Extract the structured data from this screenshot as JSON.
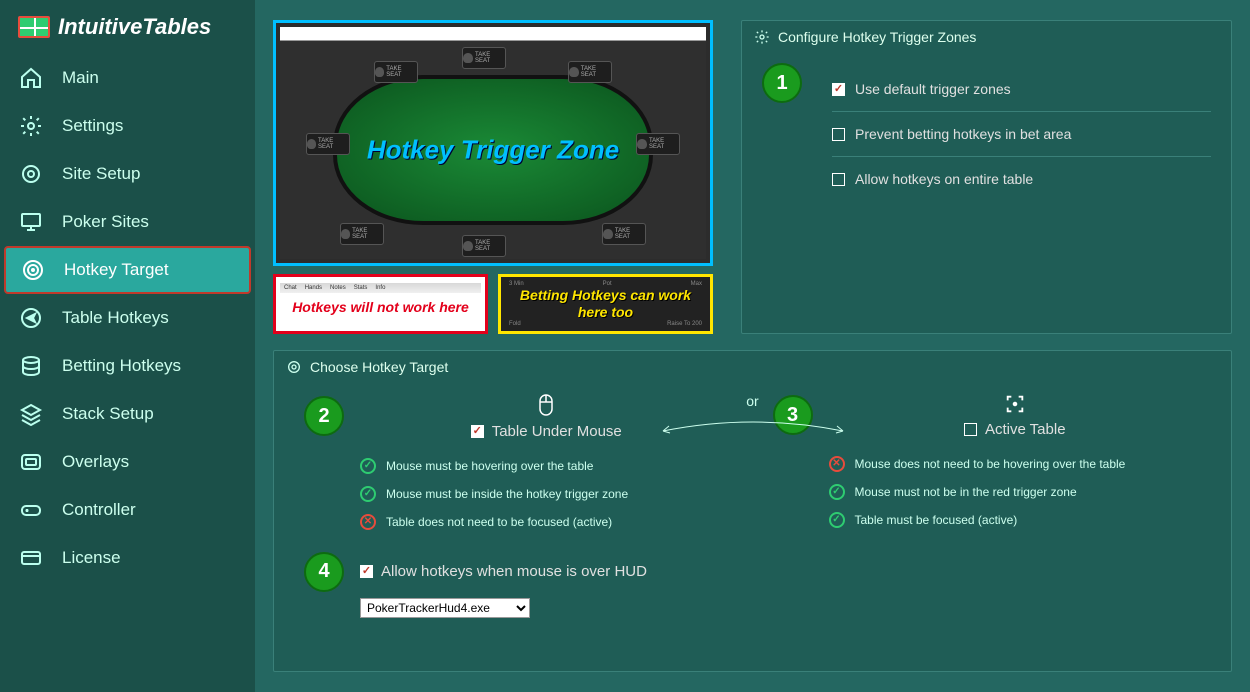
{
  "logo": {
    "text": "IntuitiveTables"
  },
  "sidebar": {
    "items": [
      {
        "label": "Main"
      },
      {
        "label": "Settings"
      },
      {
        "label": "Site Setup"
      },
      {
        "label": "Poker Sites"
      },
      {
        "label": "Hotkey Target"
      },
      {
        "label": "Table Hotkeys"
      },
      {
        "label": "Betting Hotkeys"
      },
      {
        "label": "Stack Setup"
      },
      {
        "label": "Overlays"
      },
      {
        "label": "Controller"
      },
      {
        "label": "License"
      }
    ]
  },
  "diagram": {
    "trigger_zone": "Hotkey Trigger Zone",
    "seat_label": "TAKE SEAT",
    "red_box": "Hotkeys will not work here",
    "red_tabs": [
      "Chat",
      "Hands",
      "Notes",
      "Stats",
      "Info"
    ],
    "yellow_box": "Betting Hotkeys can work here too",
    "yellow_labels": [
      "Fold",
      "3 Min",
      "Pot",
      "Max",
      "Raise To 200"
    ]
  },
  "config": {
    "title": "Configure Hotkey Trigger Zones",
    "step": "1",
    "opts": [
      {
        "label": "Use default trigger zones",
        "checked": true
      },
      {
        "label": "Prevent betting hotkeys in bet area",
        "checked": false
      },
      {
        "label": "Allow hotkeys on entire table",
        "checked": false
      }
    ]
  },
  "choose": {
    "title": "Choose Hotkey Target",
    "or": "or",
    "left": {
      "step": "2",
      "label": "Table Under Mouse",
      "checked": true,
      "bullets": [
        {
          "ok": true,
          "text": "Mouse must be hovering over the table"
        },
        {
          "ok": true,
          "text": "Mouse must be inside the hotkey trigger zone"
        },
        {
          "ok": false,
          "text": "Table does not need to be focused (active)"
        }
      ]
    },
    "right": {
      "step": "3",
      "label": "Active Table",
      "checked": false,
      "bullets": [
        {
          "ok": false,
          "text": "Mouse does not need to be hovering over the table"
        },
        {
          "ok": true,
          "text": "Mouse must not be in the red trigger zone"
        },
        {
          "ok": true,
          "text": "Table must be focused (active)"
        }
      ]
    },
    "step4": {
      "step": "4",
      "label": "Allow hotkeys when mouse is over HUD",
      "checked": true,
      "select": "PokerTrackerHud4.exe"
    }
  }
}
